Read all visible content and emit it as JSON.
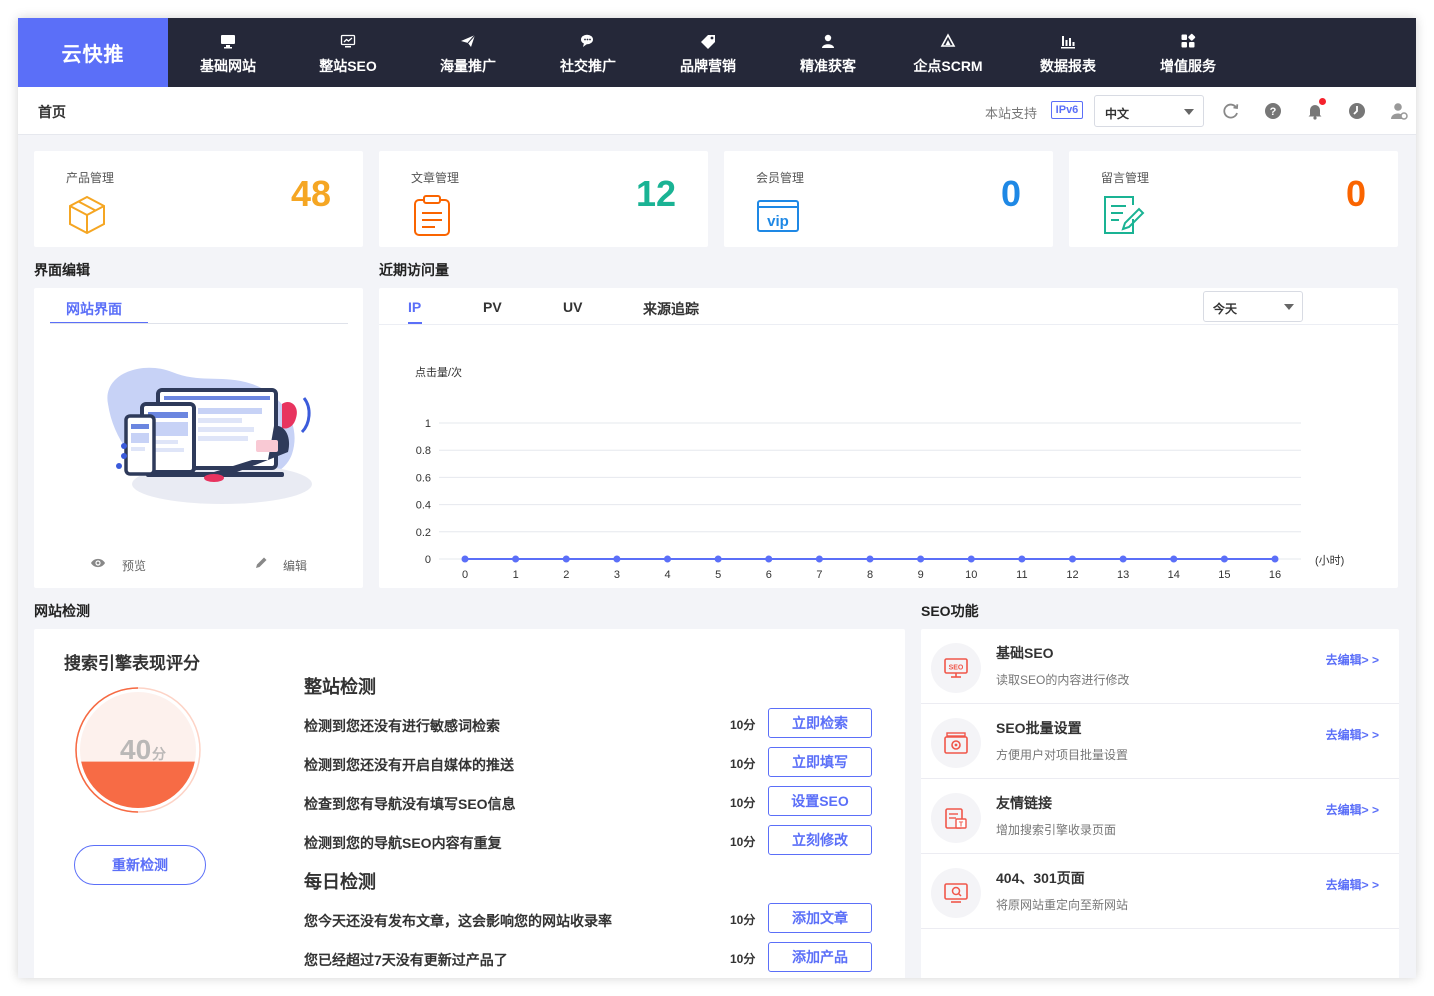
{
  "app": {
    "logo": "云快推"
  },
  "nav": [
    {
      "label": "基础网站",
      "icon": "monitor-icon"
    },
    {
      "label": "整站SEO",
      "icon": "chart-monitor-icon"
    },
    {
      "label": "海量推广",
      "icon": "paper-plane-icon"
    },
    {
      "label": "社交推广",
      "icon": "chat-bubbles-icon"
    },
    {
      "label": "品牌营销",
      "icon": "tag-icon"
    },
    {
      "label": "精准获客",
      "icon": "user-icon"
    },
    {
      "label": "企点SCRM",
      "icon": "scrm-icon"
    },
    {
      "label": "数据报表",
      "icon": "bar-chart-icon"
    },
    {
      "label": "增值服务",
      "icon": "grid-icon"
    }
  ],
  "header": {
    "breadcrumb": "首页",
    "ipv6_text": "本站支持",
    "ipv6_badge": "IPv6",
    "language": "中文"
  },
  "stats": [
    {
      "label": "产品管理",
      "value": "48",
      "color": "#f5a623",
      "icon": "cube-icon"
    },
    {
      "label": "文章管理",
      "value": "12",
      "color": "#1ab394",
      "icon": "clipboard-icon"
    },
    {
      "label": "会员管理",
      "value": "0",
      "color": "#1e88e5",
      "icon": "vip-icon"
    },
    {
      "label": "留言管理",
      "value": "0",
      "color": "#fa6400",
      "icon": "note-edit-icon"
    }
  ],
  "interface": {
    "title": "界面编辑",
    "tab": "网站界面",
    "preview": "预览",
    "edit": "编辑"
  },
  "traffic": {
    "title": "近期访问量",
    "tabs": [
      "IP",
      "PV",
      "UV",
      "来源追踪"
    ],
    "range": "今天"
  },
  "chart_data": {
    "type": "line",
    "ylabel": "点击量/次",
    "xlabel": "(小时)",
    "x": [
      0,
      1,
      2,
      3,
      4,
      5,
      6,
      7,
      8,
      9,
      10,
      11,
      12,
      13,
      14,
      15,
      16
    ],
    "series": [
      {
        "values": [
          0,
          0,
          0,
          0,
          0,
          0,
          0,
          0,
          0,
          0,
          0,
          0,
          0,
          0,
          0,
          0,
          0
        ]
      }
    ],
    "yticks": [
      "0",
      "0.2",
      "0.4",
      "0.6",
      "0.8",
      "1"
    ],
    "ylim": [
      0,
      1
    ],
    "grid": true,
    "color": "#5b6ff8"
  },
  "check": {
    "title": "网站检测",
    "score_title": "搜索引擎表现评分",
    "score_value": "40",
    "score_unit": "分",
    "score_fraction": 0.4,
    "recheck": "重新检测",
    "full_title": "整站检测",
    "full_items": [
      {
        "text": "检测到您还没有进行敏感词检索",
        "score": "10分",
        "action": "立即检索"
      },
      {
        "text": "检测到您还没有开启自媒体的推送",
        "score": "10分",
        "action": "立即填写"
      },
      {
        "text": "检查到您有导航没有填写SEO信息",
        "score": "10分",
        "action": "设置SEO"
      },
      {
        "text": "检测到您的导航SEO内容有重复",
        "score": "10分",
        "action": "立刻修改"
      }
    ],
    "daily_title": "每日检测",
    "daily_items": [
      {
        "text": "您今天还没有发布文章，这会影响您的网站收录率",
        "score": "10分",
        "action": "添加文章"
      },
      {
        "text": "您已经超过7天没有更新过产品了",
        "score": "10分",
        "action": "添加产品"
      }
    ]
  },
  "seo": {
    "title": "SEO功能",
    "items": [
      {
        "title": "基础SEO",
        "desc": "读取SEO的内容进行修改",
        "link": "去编辑> >",
        "icon": "seo-icon"
      },
      {
        "title": "SEO批量设置",
        "desc": "方便用户对项目批量设置",
        "link": "去编辑> >",
        "icon": "batch-settings-icon"
      },
      {
        "title": "友情链接",
        "desc": "增加搜索引擎收录页面",
        "link": "去编辑> >",
        "icon": "link-list-icon"
      },
      {
        "title": "404、301页面",
        "desc": "将原网站重定向至新网站",
        "link": "去编辑> >",
        "icon": "redirect-monitor-icon"
      }
    ]
  }
}
